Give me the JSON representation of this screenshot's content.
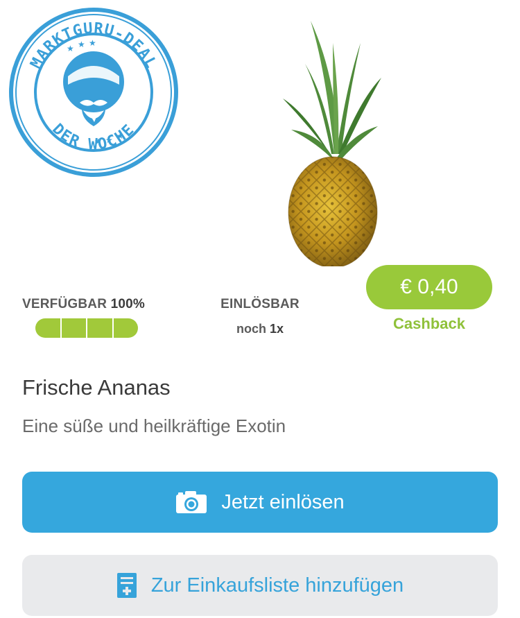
{
  "badge": {
    "top_text": "MARKTGURU-DEAL",
    "bottom_text": "DER WOCHE",
    "color": "#3a9fd8"
  },
  "product": {
    "image_icon": "pineapple-image",
    "title": "Frische Ananas",
    "description": "Eine süße und heilkräftige Exotin"
  },
  "availability": {
    "label": "VERFÜGBAR",
    "percent": "100%",
    "progress_fraction": 1.0
  },
  "redeemable": {
    "label": "EINLÖSBAR",
    "prefix": "noch",
    "count": "1x"
  },
  "cashback": {
    "amount": "€ 0,40",
    "label": "Cashback",
    "color": "#99c93a"
  },
  "buttons": {
    "redeem_label": "Jetzt einlösen",
    "redeem_icon": "camera-icon",
    "list_label": "Zur Einkaufsliste hinzufügen",
    "list_icon": "add-to-list-icon",
    "primary_color": "#35a7dd"
  }
}
